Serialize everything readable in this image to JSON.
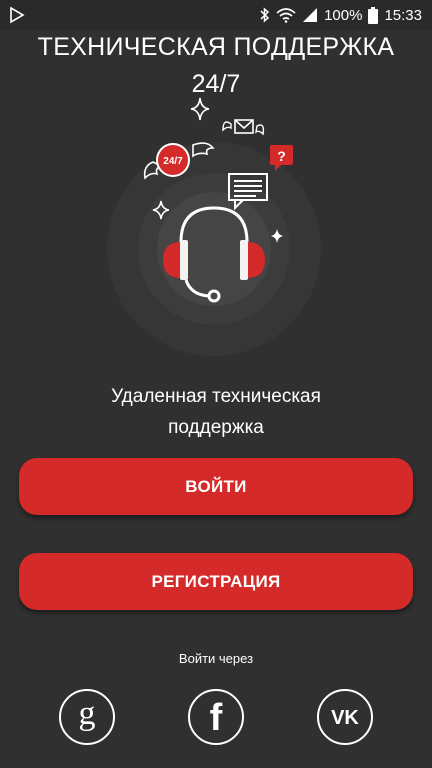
{
  "status_bar": {
    "battery": "100%",
    "time": "15:33"
  },
  "header": {
    "title": "ТЕХНИЧЕСКАЯ ПОДДЕРЖКА",
    "subtitle": "24/7"
  },
  "hero": {
    "badge_text": "24/7",
    "question_mark": "?"
  },
  "description": {
    "line1": "Удаленная техническая",
    "line2": "поддержка"
  },
  "buttons": {
    "login_label": "ВОЙТИ",
    "register_label": "РЕГИСТРАЦИЯ"
  },
  "social": {
    "via_label": "Войти через",
    "items": [
      {
        "name": "google",
        "glyph": "g"
      },
      {
        "name": "facebook",
        "glyph": "f"
      },
      {
        "name": "vk",
        "glyph": "VK"
      }
    ]
  },
  "colors": {
    "background": "#303030",
    "accent": "#d42a2a",
    "text": "#ffffff"
  }
}
